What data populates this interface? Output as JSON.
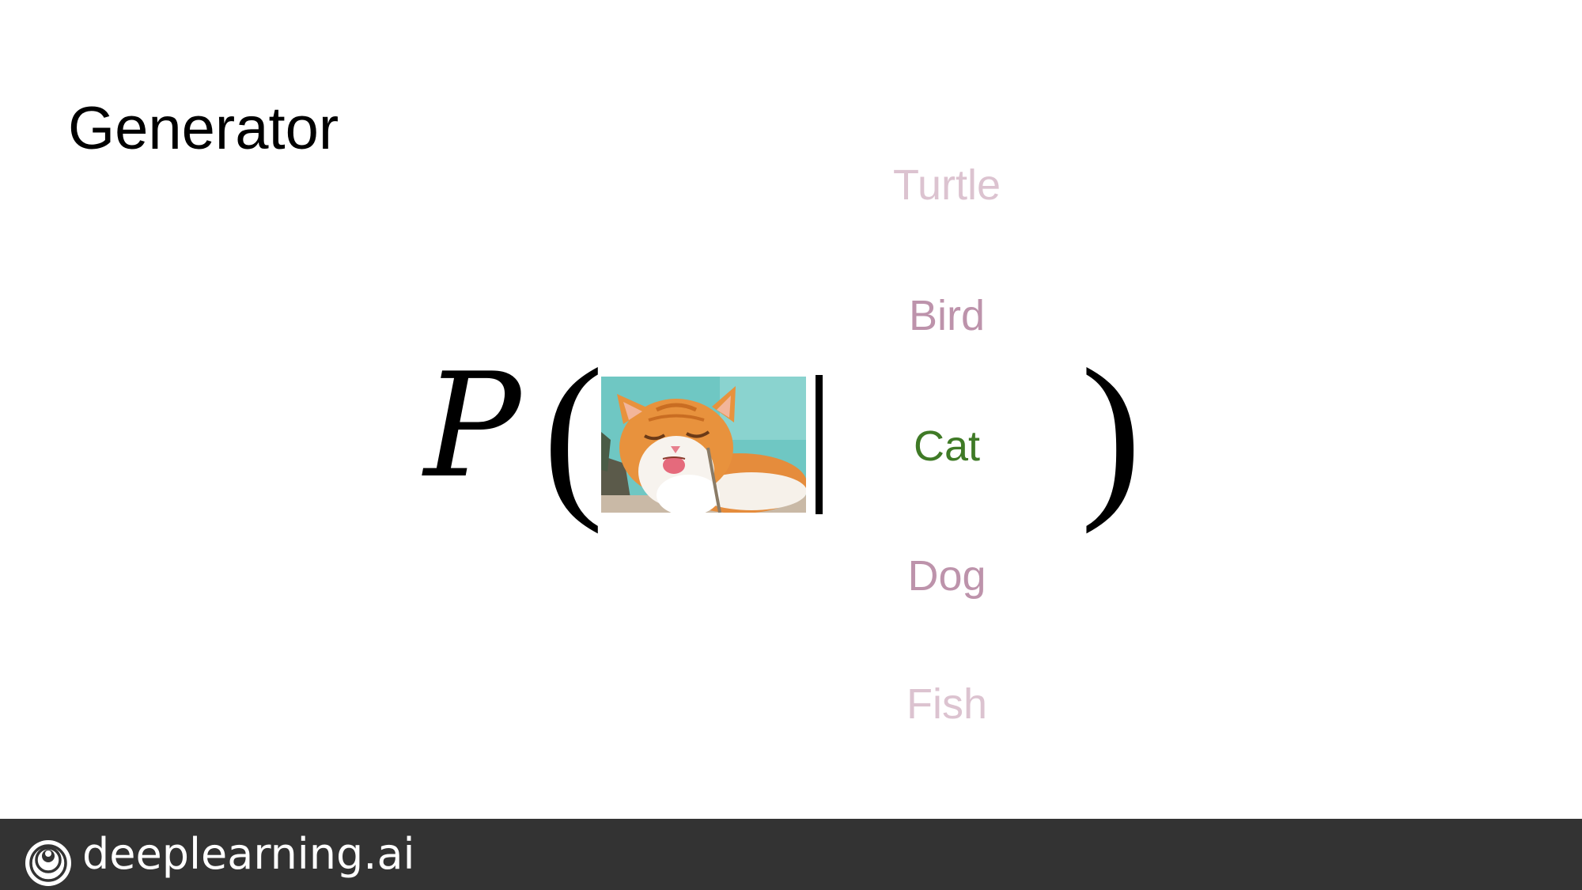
{
  "slide": {
    "title": "Generator"
  },
  "formula": {
    "function_symbol": "P",
    "open_paren": "(",
    "close_paren": ")",
    "image_subject": "cat"
  },
  "class_labels": [
    {
      "text": "Turtle",
      "color": "#dcc3d0"
    },
    {
      "text": "Bird",
      "color": "#bd93ab"
    },
    {
      "text": "Cat",
      "color": "#3f7a26"
    },
    {
      "text": "Dog",
      "color": "#bd93ab"
    },
    {
      "text": "Fish",
      "color": "#dcc3d0"
    }
  ],
  "footer": {
    "brand": "deeplearning.ai",
    "logo_icon": "deeplearning-logo-icon",
    "background": "#333333"
  }
}
